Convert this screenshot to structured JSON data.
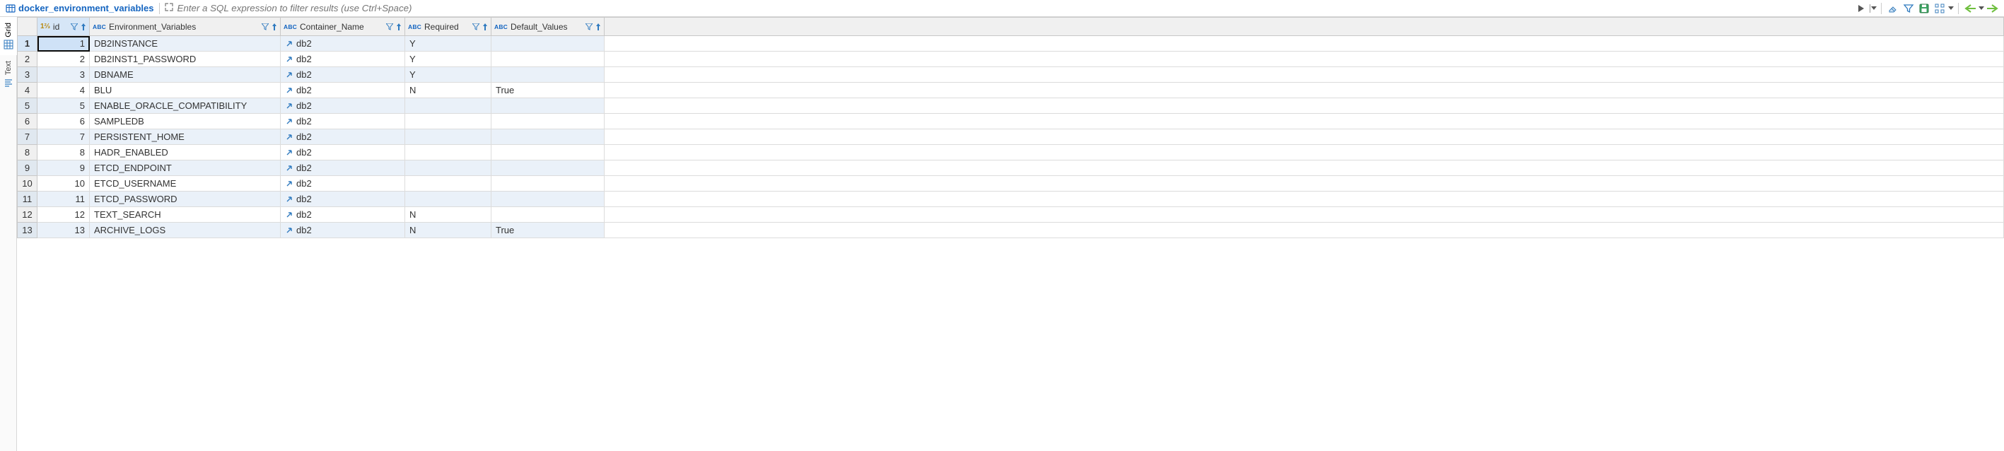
{
  "tabTitle": "docker_environment_variables",
  "filterPlaceholder": "Enter a SQL expression to filter results (use Ctrl+Space)",
  "sideTabs": {
    "grid": "Grid",
    "text": "Text"
  },
  "columns": {
    "id": "id",
    "env": "Environment_Variables",
    "cont": "Container_Name",
    "req": "Required",
    "def": "Default_Values"
  },
  "rows": [
    {
      "n": "1",
      "id": "1",
      "env": "DB2INSTANCE",
      "cont": "db2",
      "req": "Y",
      "def": ""
    },
    {
      "n": "2",
      "id": "2",
      "env": "DB2INST1_PASSWORD",
      "cont": "db2",
      "req": "Y",
      "def": ""
    },
    {
      "n": "3",
      "id": "3",
      "env": "DBNAME",
      "cont": "db2",
      "req": "Y",
      "def": ""
    },
    {
      "n": "4",
      "id": "4",
      "env": "BLU",
      "cont": "db2",
      "req": "N",
      "def": "True"
    },
    {
      "n": "5",
      "id": "5",
      "env": "ENABLE_ORACLE_COMPATIBILITY",
      "cont": "db2",
      "req": "",
      "def": ""
    },
    {
      "n": "6",
      "id": "6",
      "env": "SAMPLEDB",
      "cont": "db2",
      "req": "",
      "def": ""
    },
    {
      "n": "7",
      "id": "7",
      "env": "PERSISTENT_HOME",
      "cont": "db2",
      "req": "",
      "def": ""
    },
    {
      "n": "8",
      "id": "8",
      "env": "HADR_ENABLED",
      "cont": "db2",
      "req": "",
      "def": ""
    },
    {
      "n": "9",
      "id": "9",
      "env": "ETCD_ENDPOINT",
      "cont": "db2",
      "req": "",
      "def": ""
    },
    {
      "n": "10",
      "id": "10",
      "env": "ETCD_USERNAME",
      "cont": "db2",
      "req": "",
      "def": ""
    },
    {
      "n": "11",
      "id": "11",
      "env": "ETCD_PASSWORD",
      "cont": "db2",
      "req": "",
      "def": ""
    },
    {
      "n": "12",
      "id": "12",
      "env": "TEXT_SEARCH",
      "cont": "db2",
      "req": "N",
      "def": ""
    },
    {
      "n": "13",
      "id": "13",
      "env": "ARCHIVE_LOGS",
      "cont": "db2",
      "req": "N",
      "def": "True"
    }
  ],
  "toolbarIcons": {
    "run": "run-button",
    "menu": "result-menu",
    "eraser": "eraser-icon",
    "funnel": "panel-filter-icon",
    "save": "save-data-icon",
    "custom": "customize-icon",
    "back": "back-arrow-icon",
    "forward": "forward-arrow-icon"
  }
}
